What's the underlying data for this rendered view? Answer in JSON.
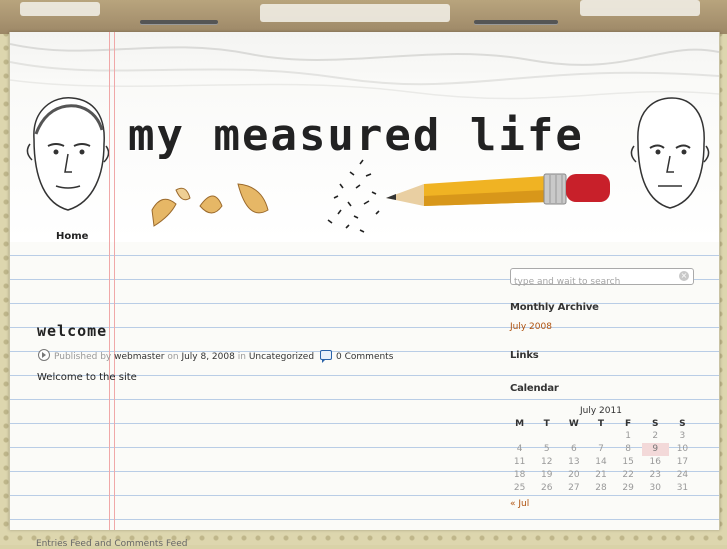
{
  "site": {
    "title": "my measured life"
  },
  "nav": {
    "items": [
      {
        "label": "Home"
      }
    ]
  },
  "post": {
    "title": "welcome",
    "meta_published_by": "Published by",
    "author": "webmaster",
    "meta_on": "on",
    "date": "July 8, 2008",
    "meta_in": "in",
    "category": "Uncategorized",
    "comments": "0 Comments",
    "body": "Welcome to the site"
  },
  "sidebar": {
    "search_placeholder": "type and wait to search",
    "archive_title": "Monthly Archive",
    "archive_link": "July 2008",
    "links_title": "Links",
    "calendar_title": "Calendar",
    "calendar": {
      "caption": "July 2011",
      "weekdays": [
        "M",
        "T",
        "W",
        "T",
        "F",
        "S",
        "S"
      ],
      "weeks": [
        [
          "",
          "",
          "",
          "",
          "1",
          "2",
          "3"
        ],
        [
          "4",
          "5",
          "6",
          "7",
          "8",
          "9",
          "10"
        ],
        [
          "11",
          "12",
          "13",
          "14",
          "15",
          "16",
          "17"
        ],
        [
          "18",
          "19",
          "20",
          "21",
          "22",
          "23",
          "24"
        ],
        [
          "25",
          "26",
          "27",
          "28",
          "29",
          "30",
          "31"
        ]
      ],
      "today": "9",
      "prev_label": "« Jul"
    }
  },
  "footer": {
    "links": "Entries Feed and Comments Feed"
  },
  "colors": {
    "link_accent": "#b0520e",
    "ruled_line": "#b9cde6",
    "margin_line": "#f0a8a8",
    "pencil_body": "#f0b323",
    "eraser": "#c8202a"
  }
}
